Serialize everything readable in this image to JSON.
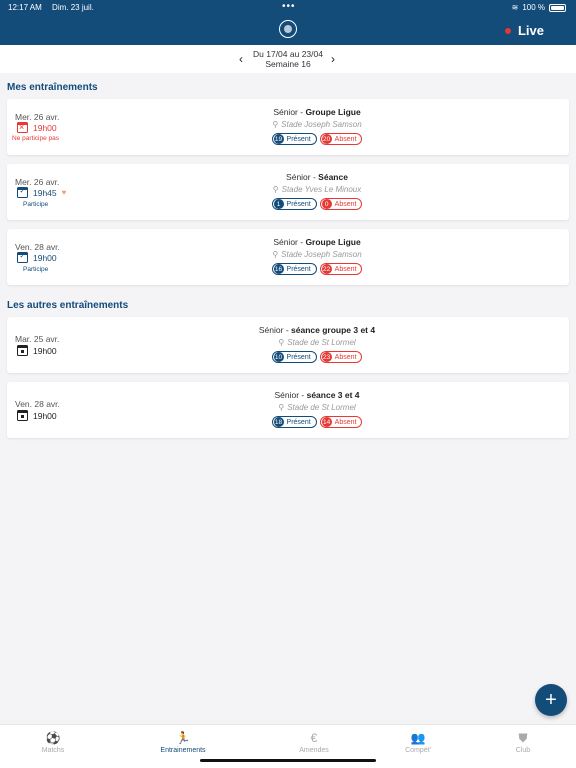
{
  "status": {
    "time": "12:17 AM",
    "date": "Dim. 23 juil.",
    "battery": "100 %"
  },
  "header": {
    "live": "Live"
  },
  "week": {
    "dates": "Du 17/04 au 23/04",
    "number": "Semaine 16"
  },
  "sections": {
    "mine": "Mes entraînements",
    "others": "Les autres entraînements"
  },
  "mine": [
    {
      "date": "Mer. 26 avr.",
      "time": "19h00",
      "status": "Ne participe pas",
      "category": "Sénior - ",
      "name": "Groupe Ligue",
      "location": "Stade Joseph Samson",
      "present": "19",
      "absent": "20",
      "present_label": "Présent",
      "absent_label": "Absent"
    },
    {
      "date": "Mer. 26 avr.",
      "time": "19h45",
      "status": "Participe",
      "category": "Sénior - ",
      "name": "Séance",
      "location": "Stade Yves Le Minoux",
      "present": "1",
      "absent": "0",
      "present_label": "Présent",
      "absent_label": "Absent"
    },
    {
      "date": "Ven. 28 avr.",
      "time": "19h00",
      "status": "Participe",
      "category": "Sénior - ",
      "name": "Groupe Ligue",
      "location": "Stade Joseph Samson",
      "present": "16",
      "absent": "22",
      "present_label": "Présent",
      "absent_label": "Absent"
    }
  ],
  "others": [
    {
      "date": "Mar. 25 avr.",
      "time": "19h00",
      "category": "Sénior - ",
      "name": "séance groupe  3 et 4",
      "location": "Stade de St Lormel",
      "present": "10",
      "absent": "23",
      "present_label": "Présent",
      "absent_label": "Absent"
    },
    {
      "date": "Ven. 28 avr.",
      "time": "19h00",
      "category": "Sénior - ",
      "name": "séance 3 et 4",
      "location": "Stade de St Lormel",
      "present": "18",
      "absent": "14",
      "present_label": "Présent",
      "absent_label": "Absent"
    }
  ],
  "fab": "+",
  "tabs": [
    "Matchs",
    "Entrainements",
    "Amendes",
    "Compét'",
    "Club"
  ],
  "colors": {
    "primary": "#134b79",
    "absent": "#e53935",
    "background": "#f4f4f6"
  }
}
